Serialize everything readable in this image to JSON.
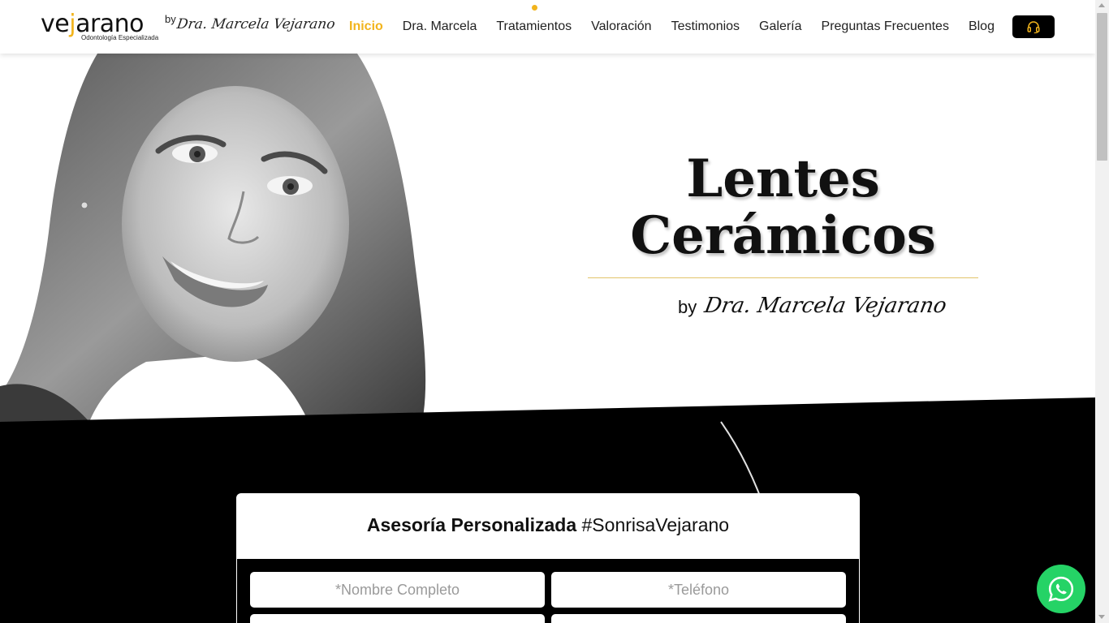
{
  "brand": {
    "logo_word_pre": "ve",
    "logo_word_accent": "j",
    "logo_word_post": "arano",
    "logo_subtitle": "Odontología Especializada",
    "logo_by": "by",
    "logo_signature": "Dra. Marcela Vejarano",
    "accent_color": "#f2b41c"
  },
  "nav": {
    "items": [
      {
        "label": "Inicio",
        "active": true
      },
      {
        "label": "Dra. Marcela"
      },
      {
        "label": "Tratamientos",
        "has_dot": true
      },
      {
        "label": "Valoración"
      },
      {
        "label": "Testimonios"
      },
      {
        "label": "Galería"
      },
      {
        "label": "Preguntas Frecuentes"
      },
      {
        "label": "Blog"
      }
    ],
    "support_icon": "headset-icon"
  },
  "hero": {
    "title_line1": "Lentes",
    "title_line2": "Cerámicos",
    "by": "by",
    "signature": "Dra. Marcela Vejarano",
    "portrait_icon": "doctor-portrait-image"
  },
  "form": {
    "title_bold": "Asesoría Personalizada",
    "title_tag": "#SonrisaVejarano",
    "name_placeholder": "*Nombre Completo",
    "phone_placeholder": "*Teléfono"
  },
  "whatsapp": {
    "icon": "whatsapp-icon",
    "color": "#25d366"
  }
}
